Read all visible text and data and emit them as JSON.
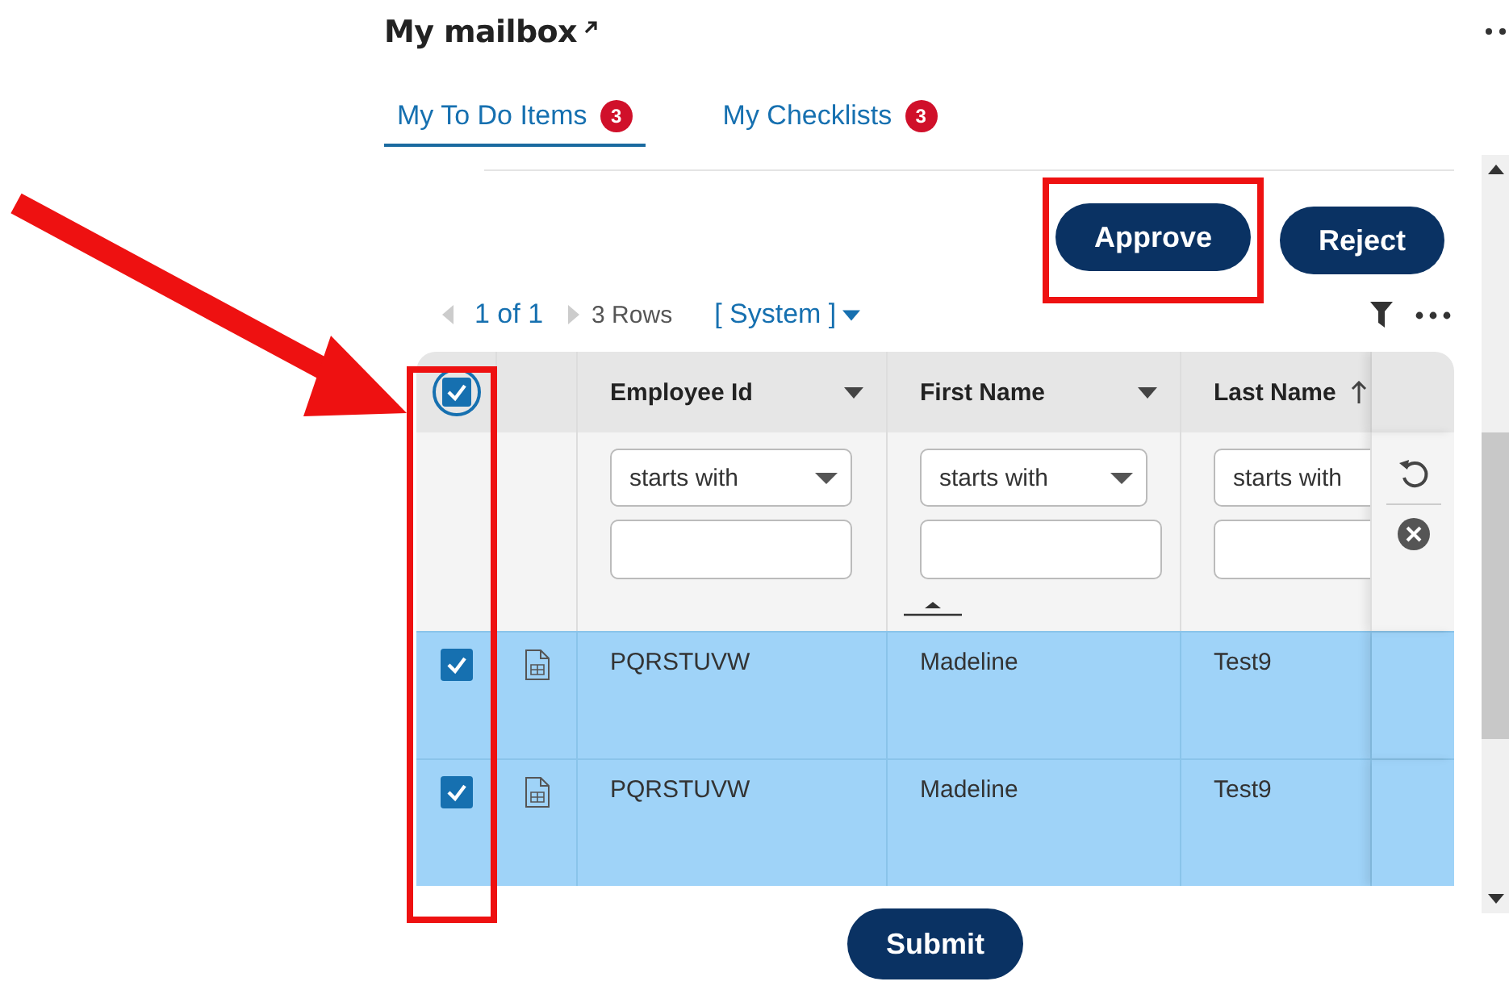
{
  "title": "My mailbox",
  "tabs": [
    {
      "label": "My To Do Items",
      "count": "3",
      "selected": true
    },
    {
      "label": "My Checklists",
      "count": "3",
      "selected": false
    }
  ],
  "actions": [
    {
      "label": "Approve",
      "highlighted": true
    },
    {
      "label": "Reject",
      "highlighted": false
    }
  ],
  "pager": {
    "page": "1 of 1",
    "rows": "3 Rows",
    "view": "[ System ]"
  },
  "select_all": {
    "checked": true,
    "highlighted": true
  },
  "columns": [
    {
      "label": "Employee Id",
      "kind": "menu"
    },
    {
      "label": "First Name",
      "kind": "menu"
    },
    {
      "label": "Last Name",
      "kind": "sorted"
    }
  ],
  "filters": [
    {
      "operator": "starts with",
      "caret": true
    },
    {
      "operator": "starts with",
      "caret": true
    },
    {
      "operator": "starts with",
      "caret": false
    }
  ],
  "rows": [
    {
      "selected": true,
      "employee_id": "PQRSTUVW",
      "first_name": "Madeline",
      "last_name": "Test9"
    },
    {
      "selected": true,
      "employee_id": "PQRSTUVW",
      "first_name": "Madeline",
      "last_name": "Test9"
    }
  ],
  "submit": "Submit"
}
